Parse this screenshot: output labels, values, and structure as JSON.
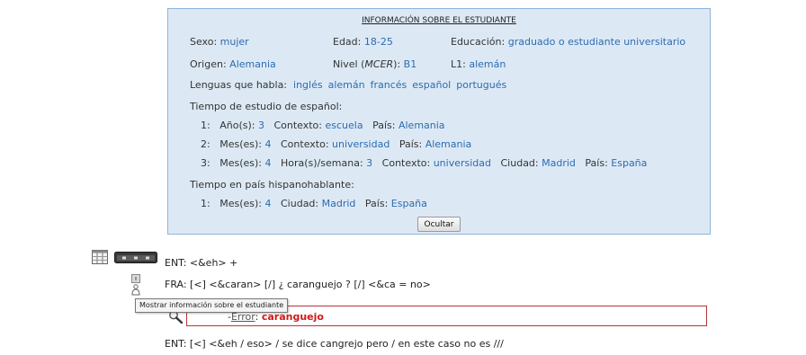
{
  "student_info": {
    "title": "INFORMACIÓN SOBRE EL ESTUDIANTE",
    "sexo_label": "Sexo:",
    "sexo_value": "mujer",
    "edad_label": "Edad:",
    "edad_value": "18-25",
    "educacion_label": "Educación:",
    "educacion_value": "graduado o estudiante universitario",
    "origen_label": "Origen:",
    "origen_value": "Alemania",
    "nivel_label_pre": "Nivel (",
    "nivel_label_em": "MCER",
    "nivel_label_post": "):",
    "nivel_value": "B1",
    "l1_label": "L1:",
    "l1_value": "alemán",
    "lenguas_label": "Lenguas que habla:",
    "lenguas": [
      "inglés",
      "alemán",
      "francés",
      "español",
      "portugués"
    ],
    "tiempo_estudio_label": "Tiempo de estudio de español:",
    "estudio_1": {
      "num": "1:",
      "dur_label": "Año(s):",
      "dur_value": "3",
      "contexto_label": "Contexto:",
      "contexto_value": "escuela",
      "pais_label": "País:",
      "pais_value": "Alemania"
    },
    "estudio_2": {
      "num": "2:",
      "dur_label": "Mes(es):",
      "dur_value": "4",
      "contexto_label": "Contexto:",
      "contexto_value": "universidad",
      "pais_label": "País:",
      "pais_value": "Alemania"
    },
    "estudio_3": {
      "num": "3:",
      "dur_label": "Mes(es):",
      "dur_value": "4",
      "horas_label": "Hora(s)/semana:",
      "horas_value": "3",
      "contexto_label": "Contexto:",
      "contexto_value": "universidad",
      "ciudad_label": "Ciudad:",
      "ciudad_value": "Madrid",
      "pais_label": "País:",
      "pais_value": "España"
    },
    "tiempo_pais_label": "Tiempo en país hispanohablante:",
    "pais_1": {
      "num": "1:",
      "dur_label": "Mes(es):",
      "dur_value": "4",
      "ciudad_label": "Ciudad:",
      "ciudad_value": "Madrid",
      "pais_label": "País:",
      "pais_value": "España"
    },
    "hide_button": "Ocultar"
  },
  "icons": {
    "table": "table-icon",
    "keyboard": "keyboard-icon",
    "person": "person-info-icon",
    "magnifier": "magnifier-icon"
  },
  "transcript": {
    "line1": "ENT: <&eh> +",
    "line2": "FRA: [<] <&caran> [/] ¿ caranguejo ? [/] <&ca = no>",
    "tooltip": "Mostrar información sobre el estudiante",
    "error_prefix": "-",
    "error_label": "Error",
    "error_colon": ":",
    "error_value": "caranguejo",
    "line3": "ENT: [<] <&eh / eso> / se dice cangrejo pero / en este caso no es ///"
  },
  "colors": {
    "panel_bg": "#dce9f5",
    "panel_border": "#8fb4d8",
    "value_blue": "#2e6bb0",
    "error_red": "#d21818",
    "error_border": "#b73636"
  }
}
